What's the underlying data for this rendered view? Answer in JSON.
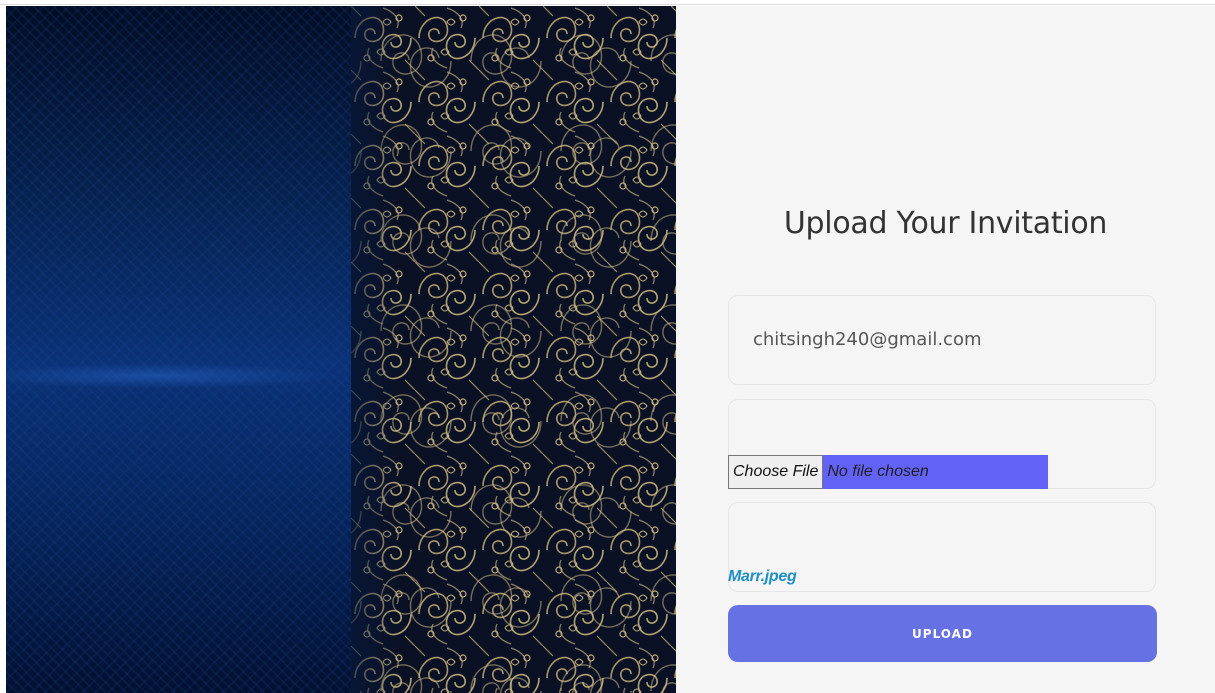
{
  "page": {
    "title": "Upload Your Invitation"
  },
  "form": {
    "email_value": "chitsingh240@gmail.com",
    "file_input": {
      "button_label": "Choose File",
      "status_text": "No file chosen"
    },
    "uploaded_file_name": "Marr.jpeg",
    "upload_label": "UPLOAD"
  },
  "colors": {
    "panel_background": "#f5f5f5",
    "upload_button": "#6671e3",
    "file_status_highlight": "#6262f6",
    "file_link": "#1f8fc4"
  },
  "icons": {
    "hero": "ornamental-pattern-image"
  }
}
